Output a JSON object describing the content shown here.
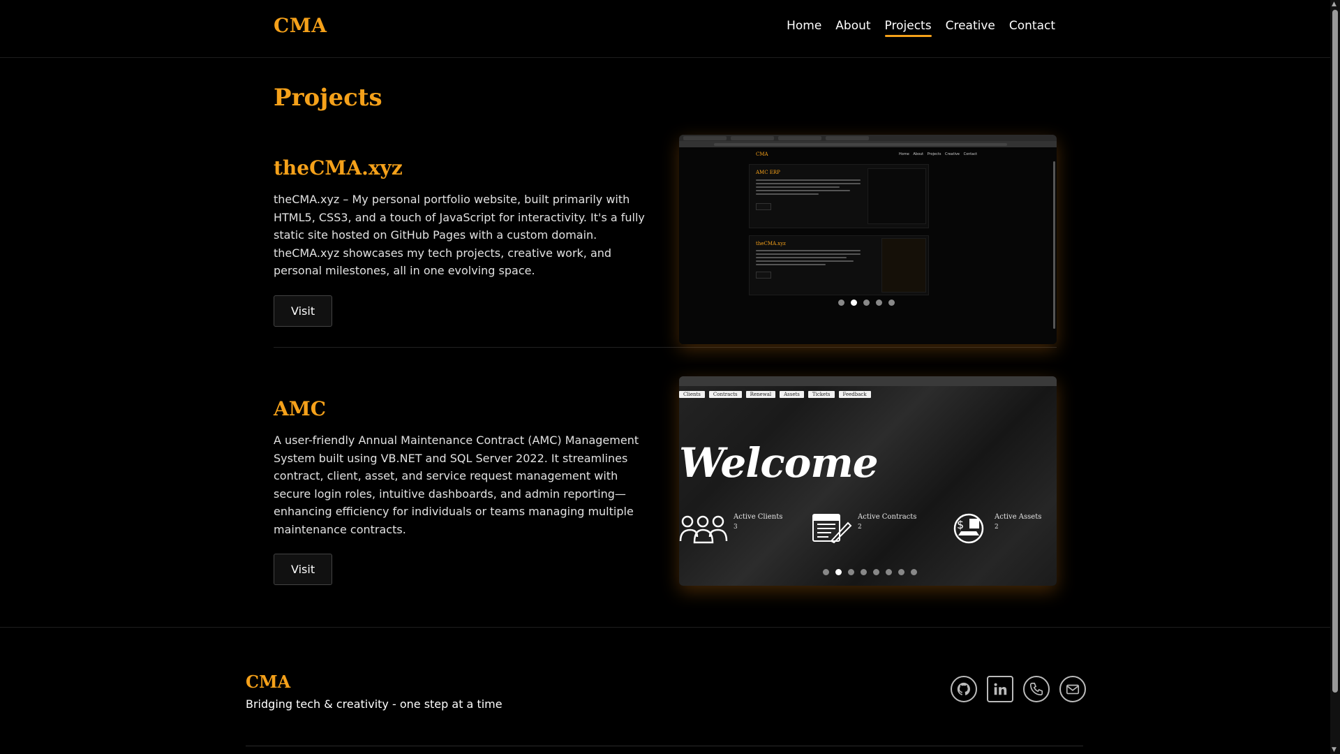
{
  "header": {
    "logo": "CMA",
    "nav": [
      "Home",
      "About",
      "Projects",
      "Creative",
      "Contact"
    ],
    "active_nav": "Projects"
  },
  "main": {
    "title": "Projects",
    "projects": [
      {
        "title": "theCMA.xyz",
        "description": "theCMA.xyz – My personal portfolio website, built primarily with HTML5, CSS3, and a touch of JavaScript for interactivity. It's a fully static site hosted on GitHub Pages with a custom domain. theCMA.xyz showcases my tech projects, creative work, and personal milestones, all in one evolving space.",
        "button": "Visit",
        "preview": {
          "logo": "CMA",
          "nav": "Home About Projects Creative Contact",
          "card1_title": "AMC ERP",
          "card2_title": "theCMA.xyz",
          "slides": 5,
          "active_slide": 2
        }
      },
      {
        "title": "AMC",
        "description": "A user-friendly Annual Maintenance Contract (AMC) Management System built using VB.NET and SQL Server 2022. It streamlines contract, client, asset, and service request management with secure login roles, intuitive dashboards, and admin reporting—enhancing efficiency for individuals or teams managing multiple maintenance contracts.",
        "button": "Visit",
        "preview": {
          "tabs": [
            "Clients",
            "Contracts",
            "Renewal",
            "Assets",
            "Tickets",
            "Feedback"
          ],
          "welcome": "Welcome",
          "stats": [
            {
              "label": "Active Clients",
              "value": "3",
              "icon": "people-icon"
            },
            {
              "label": "Active Contracts",
              "value": "2",
              "icon": "contract-icon"
            },
            {
              "label": "Active Assets",
              "value": "2",
              "icon": "assets-icon"
            }
          ],
          "slides": 8,
          "active_slide": 2
        }
      }
    ]
  },
  "footer": {
    "logo": "CMA",
    "tagline": "Bridging tech & creativity - one step at a time",
    "socials": [
      "github-icon",
      "linkedin-icon",
      "whatsapp-icon",
      "mail-icon"
    ]
  },
  "colors": {
    "accent": "#f5a11a",
    "background": "#000000",
    "text": "#e8e8e8"
  }
}
